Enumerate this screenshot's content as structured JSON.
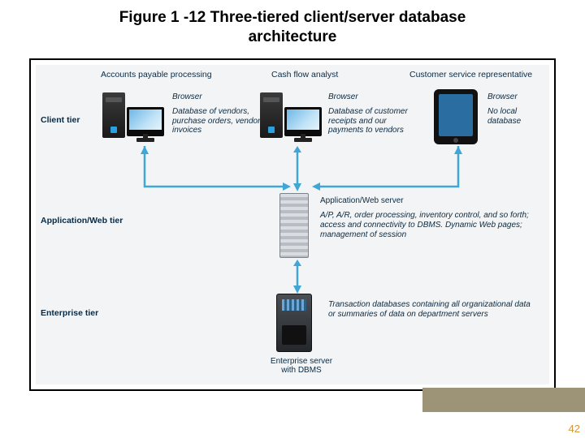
{
  "title_line1": "Figure 1 -12 Three-tiered client/server database",
  "title_line2": "architecture",
  "page_number": "42",
  "tiers": {
    "client": "Client tier",
    "app": "Application/Web tier",
    "enterprise": "Enterprise tier"
  },
  "clients": {
    "acct": {
      "heading": "Accounts payable processing",
      "browser": "Browser",
      "caption": "Database of vendors, purchase orders, vendor invoices"
    },
    "cash": {
      "heading": "Cash flow analyst",
      "browser": "Browser",
      "caption": "Database of customer receipts and our payments to vendors"
    },
    "cust": {
      "heading": "Customer service representative",
      "browser": "Browser",
      "caption": "No local database"
    }
  },
  "app_server": {
    "label": "Application/Web server",
    "caption": "A/P, A/R, order processing, inventory control, and so forth; access and connectivity to DBMS. Dynamic Web pages; management of session"
  },
  "enterprise_server": {
    "label": "Enterprise server with DBMS",
    "caption": "Transaction databases containing all organizational data or summaries of data on department servers"
  }
}
